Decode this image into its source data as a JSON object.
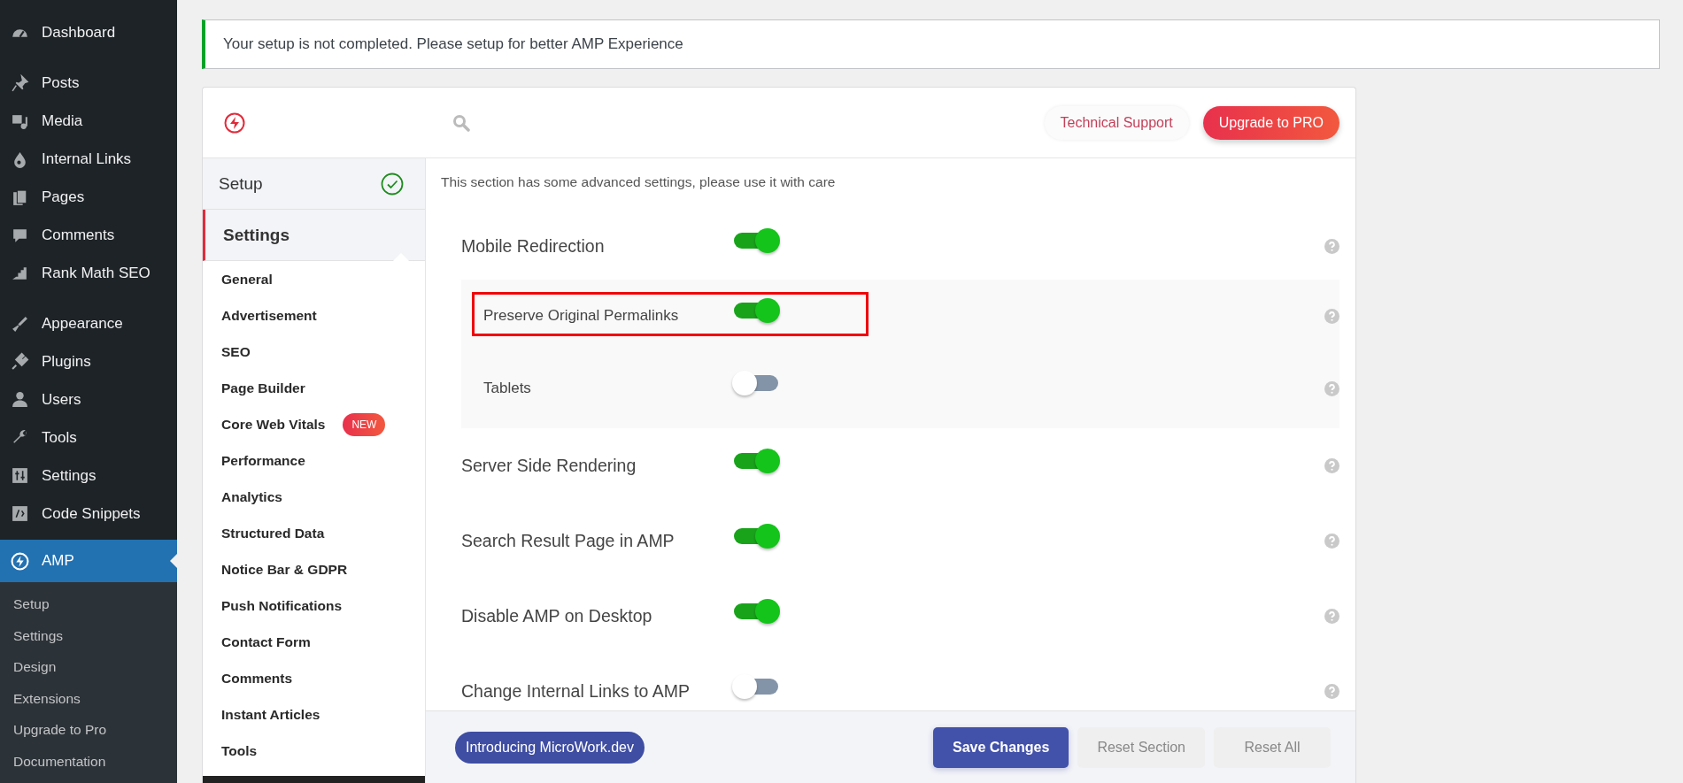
{
  "admin_menu": {
    "items": [
      {
        "label": "Dashboard",
        "selected": false
      },
      {
        "label": "Posts",
        "selected": false
      },
      {
        "label": "Media",
        "selected": false
      },
      {
        "label": "Internal Links",
        "selected": false
      },
      {
        "label": "Pages",
        "selected": false
      },
      {
        "label": "Comments",
        "selected": false
      },
      {
        "label": "Rank Math SEO",
        "selected": false
      },
      {
        "label": "Appearance",
        "selected": false
      },
      {
        "label": "Plugins",
        "selected": false
      },
      {
        "label": "Users",
        "selected": false
      },
      {
        "label": "Tools",
        "selected": false
      },
      {
        "label": "Settings",
        "selected": false
      },
      {
        "label": "Code Snippets",
        "selected": false
      },
      {
        "label": "AMP",
        "selected": true
      }
    ],
    "submenu": [
      {
        "label": "Setup",
        "selected": false
      },
      {
        "label": "Settings",
        "selected": false
      },
      {
        "label": "Design",
        "selected": false
      },
      {
        "label": "Extensions",
        "selected": false
      },
      {
        "label": "Upgrade to Pro",
        "selected": false
      },
      {
        "label": "Documentation",
        "selected": false
      }
    ]
  },
  "notice": {
    "text": "Your setup is not completed. Please setup for better AMP Experience"
  },
  "header": {
    "buttons": [
      {
        "label": "Technical Support",
        "kind": "outline"
      },
      {
        "label": "Upgrade to PRO",
        "kind": "primary"
      }
    ]
  },
  "nav": {
    "sections": [
      {
        "label": "Setup",
        "completed": true,
        "selected": false
      },
      {
        "label": "Settings",
        "completed": false,
        "selected": true
      }
    ],
    "items": [
      {
        "label": "General"
      },
      {
        "label": "Advertisement"
      },
      {
        "label": "SEO"
      },
      {
        "label": "Page Builder"
      },
      {
        "label": "Core Web Vitals",
        "badge": "NEW"
      },
      {
        "label": "Performance"
      },
      {
        "label": "Analytics"
      },
      {
        "label": "Structured Data"
      },
      {
        "label": "Notice Bar & GDPR"
      },
      {
        "label": "Push Notifications"
      },
      {
        "label": "Contact Form"
      },
      {
        "label": "Comments"
      },
      {
        "label": "Instant Articles"
      },
      {
        "label": "Tools"
      }
    ]
  },
  "description": "This section has some advanced settings, please use it with care",
  "options": [
    {
      "label": "Mobile Redirection",
      "on": true,
      "children": [
        {
          "label": "Preserve Original Permalinks",
          "on": true,
          "highlighted": true
        },
        {
          "label": "Tablets",
          "on": false,
          "highlighted": false
        }
      ]
    },
    {
      "label": "Server Side Rendering",
      "on": true
    },
    {
      "label": "Search Result Page in AMP",
      "on": true
    },
    {
      "label": "Disable AMP on Desktop",
      "on": true
    },
    {
      "label": "Change Internal Links to AMP",
      "on": false
    }
  ],
  "footer": {
    "promo": "Introducing MicroWork.dev",
    "buttons": [
      {
        "label": "Save Changes",
        "kind": "primary"
      },
      {
        "label": "Reset Section",
        "kind": "plain"
      },
      {
        "label": "Reset All",
        "kind": "plain"
      }
    ]
  }
}
